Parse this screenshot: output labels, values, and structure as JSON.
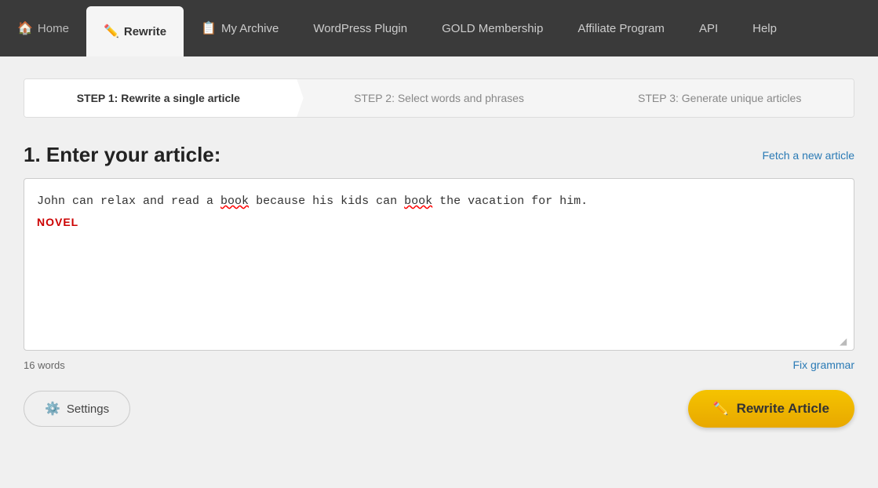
{
  "navbar": {
    "items": [
      {
        "id": "home",
        "label": "Home",
        "icon": "🏠",
        "active": false
      },
      {
        "id": "rewrite",
        "label": "Rewrite",
        "icon": "✏️",
        "active": true
      },
      {
        "id": "my-archive",
        "label": "My Archive",
        "icon": "📋",
        "active": false
      },
      {
        "id": "wordpress-plugin",
        "label": "WordPress Plugin",
        "icon": "",
        "active": false
      },
      {
        "id": "gold-membership",
        "label": "GOLD Membership",
        "icon": "",
        "active": false
      },
      {
        "id": "affiliate-program",
        "label": "Affiliate Program",
        "icon": "",
        "active": false
      },
      {
        "id": "api",
        "label": "API",
        "icon": "",
        "active": false
      },
      {
        "id": "help",
        "label": "Help",
        "icon": "",
        "active": false
      }
    ]
  },
  "steps": [
    {
      "id": "step1",
      "label": "STEP 1: Rewrite a single article",
      "active": true
    },
    {
      "id": "step2",
      "label": "STEP 2: Select words and phrases",
      "active": false
    },
    {
      "id": "step3",
      "label": "STEP 3: Generate unique articles",
      "active": false
    }
  ],
  "article_section": {
    "title": "1. Enter your article:",
    "fetch_link": "Fetch a new article",
    "article_text": "John can relax and read a book because his kids can book the vacation for him.",
    "spellcheck_word1": "book",
    "autocorrect_popup": "NOVEL",
    "word_count_label": "16 words",
    "fix_grammar_label": "Fix grammar"
  },
  "buttons": {
    "settings_label": "Settings",
    "rewrite_label": "Rewrite Article"
  }
}
